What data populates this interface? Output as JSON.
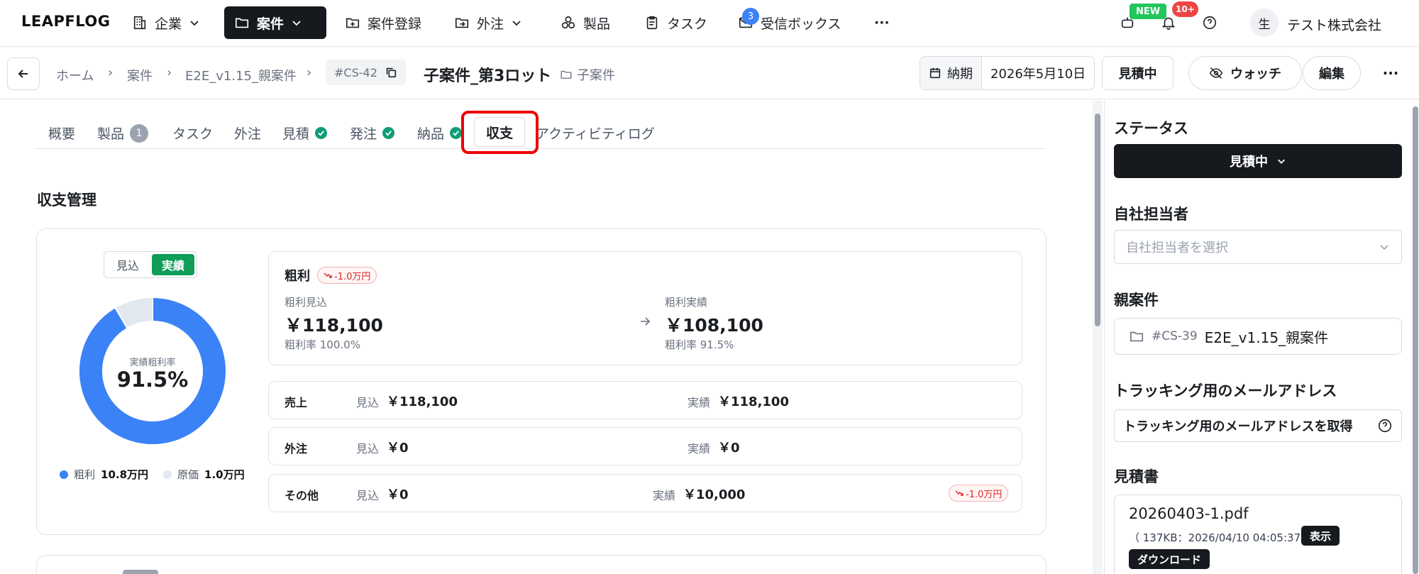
{
  "app": {
    "logo": "LEAPFLOG"
  },
  "nav": {
    "items": [
      {
        "label": "企業"
      },
      {
        "label": "案件"
      },
      {
        "label": "案件登録"
      },
      {
        "label": "外注"
      },
      {
        "label": "製品"
      },
      {
        "label": "タスク"
      },
      {
        "label": "受信ボックス",
        "badge": "3"
      }
    ],
    "more": "···",
    "new_badge": "NEW",
    "notif_badge": "10+",
    "avatar": "生",
    "company": "テスト株式会社"
  },
  "breadcrumb": {
    "items": [
      "ホーム",
      "案件",
      "E2E_v1.15_親案件"
    ],
    "sep": "›",
    "id": "#CS-42",
    "title": "子案件_第3ロット",
    "tag": "子案件"
  },
  "header_actions": {
    "due_label": "納期",
    "due_value": "2026年5月10日",
    "status": "見積中",
    "watch": "ウォッチ",
    "edit": "編集",
    "more": "···"
  },
  "tabs": [
    {
      "label": "概要"
    },
    {
      "label": "製品",
      "count": "1"
    },
    {
      "label": "タスク"
    },
    {
      "label": "外注"
    },
    {
      "label": "見積",
      "done": true
    },
    {
      "label": "発注",
      "done": true
    },
    {
      "label": "納品",
      "done": true
    },
    {
      "label": "収支",
      "active": true
    },
    {
      "label": "アクティビティログ"
    }
  ],
  "section": {
    "title": "収支管理"
  },
  "toggle": {
    "options": [
      "見込",
      "実績"
    ],
    "selected": "実績"
  },
  "donut": {
    "center_label": "実績粗利率",
    "center_value": "91.5%",
    "segments": [
      {
        "name": "粗利",
        "value": 10.8,
        "display": "10.8万円",
        "color": "#3b82f6"
      },
      {
        "name": "原価",
        "value": 1.0,
        "display": "1.0万円",
        "color": "#e2e8f0"
      }
    ]
  },
  "profit": {
    "title": "粗利",
    "diff": "-1.0万円",
    "planned_label": "粗利見込",
    "planned_value": "￥118,100",
    "planned_rate": "粗利率 100.0%",
    "actual_label": "粗利実績",
    "actual_value": "￥108,100",
    "actual_rate": "粗利率 91.5%"
  },
  "rows": [
    {
      "label": "売上",
      "plan_label": "見込",
      "plan": "￥118,100",
      "actual_label": "実績",
      "actual": "￥118,100"
    },
    {
      "label": "外注",
      "plan_label": "見込",
      "plan": "￥0",
      "actual_label": "実績",
      "actual": "￥0"
    },
    {
      "label": "その他",
      "plan_label": "見込",
      "plan": "￥0",
      "actual_label": "実績",
      "actual": "￥10,000",
      "diff": "-1.0万円"
    }
  ],
  "sidebar": {
    "status_title": "ステータス",
    "status_value": "見積中",
    "owner_title": "自社担当者",
    "owner_placeholder": "自社担当者を選択",
    "parent_title": "親案件",
    "parent_id": "#CS-39",
    "parent_name": "E2E_v1.15_親案件",
    "tracking_title": "トラッキング用のメールアドレス",
    "tracking_button": "トラッキング用のメールアドレスを取得",
    "quote_title": "見積書",
    "file_name": "20260403-1.pdf",
    "file_meta": "（ 137KB：2026/04/10 04:05:37 ）",
    "view": "表示",
    "download": "ダウンロード"
  }
}
